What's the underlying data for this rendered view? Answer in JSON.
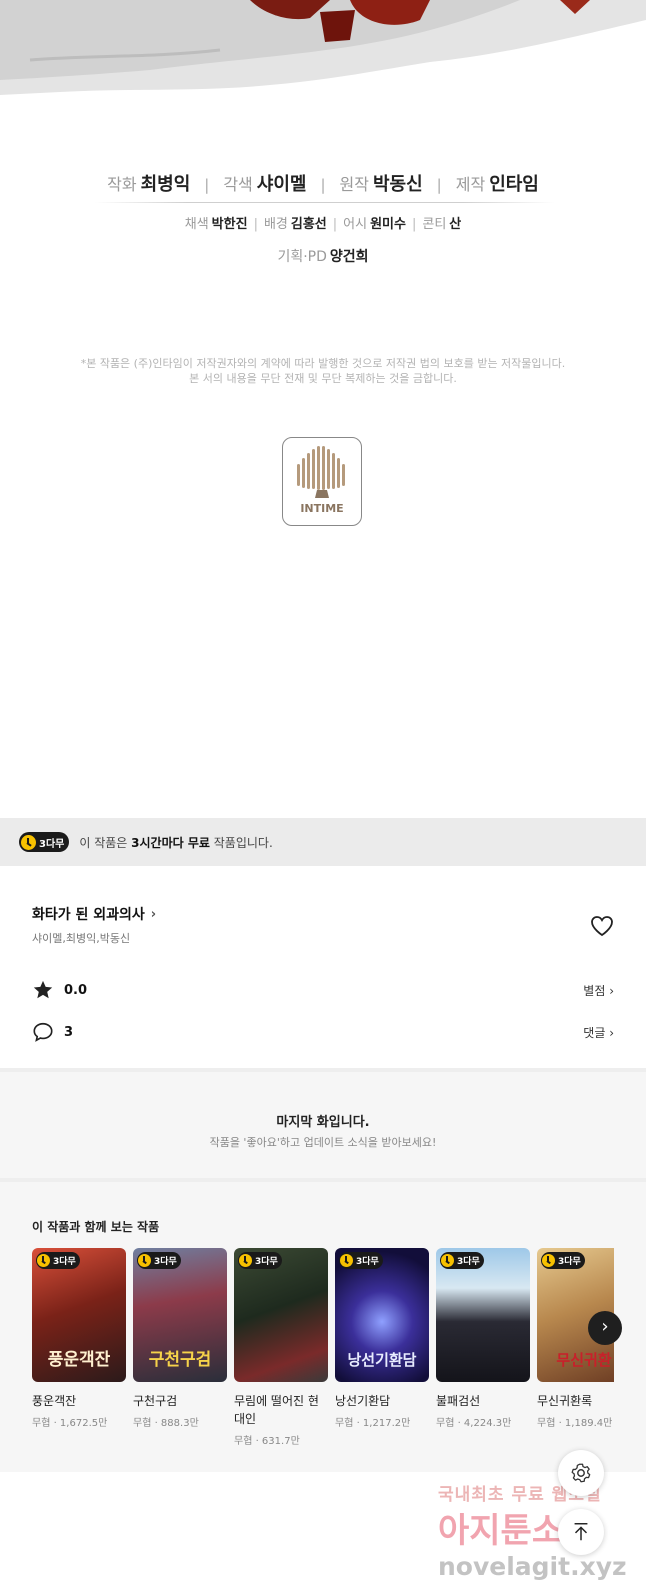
{
  "credits": {
    "main": [
      {
        "role": "작화",
        "name": "최병익"
      },
      {
        "role": "각색",
        "name": "샤이멜"
      },
      {
        "role": "원작",
        "name": "박동신"
      },
      {
        "role": "제작",
        "name": "인타임"
      }
    ],
    "sub": [
      {
        "role": "채색",
        "name": "박한진"
      },
      {
        "role": "배경",
        "name": "김홍선"
      },
      {
        "role": "어시",
        "name": "원미수"
      },
      {
        "role": "콘티",
        "name": "산"
      }
    ],
    "pd": {
      "role": "기획·PD",
      "name": "양건희"
    },
    "notice_line1": "*본 작품은 (주)인타임이 저작권자와의 계약에 따라 발행한 것으로 저작권 법의 보호를 받는 저작물입니다.",
    "notice_line2": "본 서의 내용을 무단 전재 및 무단 복제하는 것을 금합니다.",
    "logo_text": "INTIME"
  },
  "free_banner": {
    "badge": "3다무",
    "text_prefix": "이 작품은 ",
    "text_bold": "3시간마다 무료",
    "text_suffix": " 작품입니다."
  },
  "work": {
    "title": "화타가 된 외과의사",
    "authors": "샤이멜,최병익,박동신",
    "rating": "0.0",
    "rating_link": "별점",
    "comments": "3",
    "comments_link": "댓글"
  },
  "last_episode": {
    "title": "마지막 화입니다.",
    "subtitle": "작품을 '좋아요'하고 업데이트 소식을 받아보세요!"
  },
  "recommendations": {
    "title": "이 작품과 함께 보는 작품",
    "items": [
      {
        "badge": "3다무",
        "name": "풍운객잔",
        "meta": "무협 · 1,672.5만",
        "cover": "풍운객잔"
      },
      {
        "badge": "3다무",
        "name": "구천구검",
        "meta": "무협 · 888.3만",
        "cover": "구천구검"
      },
      {
        "badge": "3다무",
        "name": "무림에 떨어진 현대인",
        "meta": "무협 · 631.7만",
        "cover": ""
      },
      {
        "badge": "3다무",
        "name": "낭선기환담",
        "meta": "무협 · 1,217.2만",
        "cover": "낭선기환담"
      },
      {
        "badge": "3다무",
        "name": "불패검선",
        "meta": "무협 · 4,224.3만",
        "cover": ""
      },
      {
        "badge": "3다무",
        "name": "무신귀환록",
        "meta": "무협 · 1,189.4만",
        "cover": "무신귀환"
      }
    ]
  },
  "watermark": {
    "line1": "국내최초 무료 웹소설",
    "line2": "아지툰소설",
    "line3": "novelagit.xyz"
  },
  "colors": {
    "badge_bg": "#1a1a1a",
    "badge_clock": "#f7c100",
    "section_bg": "#f6f6f6"
  }
}
